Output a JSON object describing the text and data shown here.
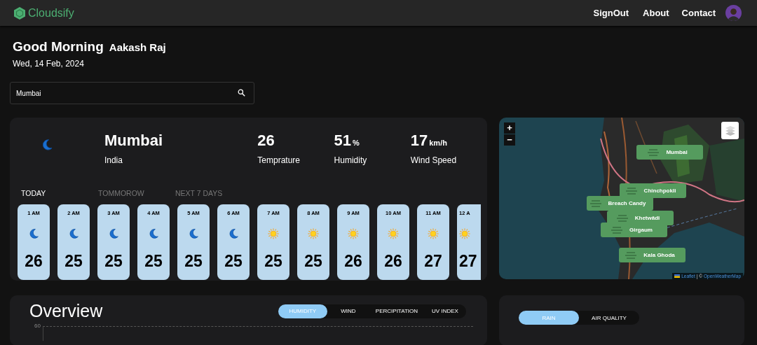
{
  "header": {
    "logo": "Cloudsify",
    "nav": [
      "SignOut",
      "About",
      "Contact"
    ]
  },
  "greeting": {
    "title": "Good Morning",
    "name": "Aakash Raj",
    "date": "Wed, 14 Feb, 2024"
  },
  "search": {
    "value": "Mumbai"
  },
  "current": {
    "kind": "moon",
    "city": "Mumbai",
    "country": "India",
    "stats": [
      {
        "value": "26",
        "label": "Temprature"
      },
      {
        "value": "51",
        "unit": "%",
        "label": "Humidity"
      },
      {
        "value": "17",
        "unit": "km/h",
        "label": "Wind Speed"
      }
    ]
  },
  "tabs": [
    {
      "label": "TODAY",
      "selected": true
    },
    {
      "label": "TOMMOROW",
      "selected": false
    },
    {
      "label": "NEXT 7 DAYS",
      "selected": false
    }
  ],
  "hours": [
    {
      "time": "1 AM",
      "kind": "moon",
      "temp": "26"
    },
    {
      "time": "2 AM",
      "kind": "moon",
      "temp": "25"
    },
    {
      "time": "3 AM",
      "kind": "moon",
      "temp": "25"
    },
    {
      "time": "4 AM",
      "kind": "moon",
      "temp": "25"
    },
    {
      "time": "5 AM",
      "kind": "moon",
      "temp": "25"
    },
    {
      "time": "6 AM",
      "kind": "moon",
      "temp": "25"
    },
    {
      "time": "7 AM",
      "kind": "sun",
      "temp": "25"
    },
    {
      "time": "8 AM",
      "kind": "sun",
      "temp": "25"
    },
    {
      "time": "9 AM",
      "kind": "sun",
      "temp": "26"
    },
    {
      "time": "10 AM",
      "kind": "sun",
      "temp": "26"
    },
    {
      "time": "11 AM",
      "kind": "sun",
      "temp": "27"
    },
    {
      "time": "12 A",
      "kind": "sun",
      "temp": "27",
      "partial": true
    }
  ],
  "map": {
    "zoom_in": "+",
    "zoom_out": "−",
    "markers": [
      "Mumbai",
      "Chinchpokli",
      "Breach Candy",
      "Khetwādi",
      "Girgaum",
      "Kala Ghoda"
    ],
    "attribution": {
      "link1": "Leaflet",
      "separator": "| ©",
      "link2": "OpenWeatherMap"
    }
  },
  "overview": {
    "title": "Overview",
    "toggles": [
      {
        "label": "HUMIDITY",
        "selected": true
      },
      {
        "label": "WIND",
        "selected": false
      },
      {
        "label": "PERCIPITATION",
        "selected": false
      },
      {
        "label": "UV INDEX",
        "selected": false
      }
    ],
    "y_tick": "60"
  },
  "side_panel": {
    "toggles": [
      {
        "label": "RAIN",
        "selected": true
      },
      {
        "label": "AIR QUALITY",
        "selected": false
      }
    ]
  }
}
